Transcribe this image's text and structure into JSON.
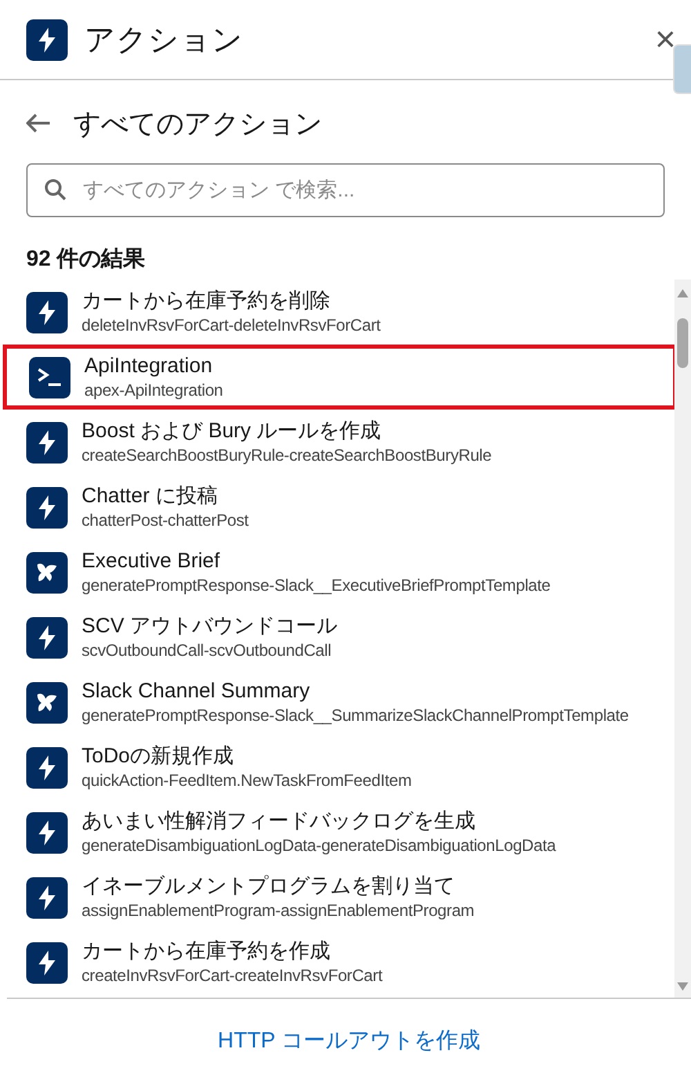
{
  "header": {
    "title": "アクション",
    "close": "×"
  },
  "subheader": {
    "title": "すべてのアクション"
  },
  "search": {
    "placeholder": "すべてのアクション で検索..."
  },
  "results": {
    "count": "92 件の結果"
  },
  "actions": [
    {
      "kind": "flow",
      "title": "カートから在庫予約を削除",
      "subtitle": "deleteInvRsvForCart-deleteInvRsvForCart",
      "highlighted": false
    },
    {
      "kind": "apex",
      "title": "ApiIntegration",
      "subtitle": "apex-ApiIntegration",
      "highlighted": true
    },
    {
      "kind": "flow",
      "title": "Boost および Bury ルールを作成",
      "subtitle": "createSearchBoostBuryRule-createSearchBoostBuryRule",
      "highlighted": false
    },
    {
      "kind": "flow",
      "title": "Chatter に投稿",
      "subtitle": "chatterPost-chatterPost",
      "highlighted": false
    },
    {
      "kind": "prompt",
      "title": "Executive Brief",
      "subtitle": "generatePromptResponse-Slack__ExecutiveBriefPromptTemplate",
      "highlighted": false
    },
    {
      "kind": "flow",
      "title": "SCV アウトバウンドコール",
      "subtitle": "scvOutboundCall-scvOutboundCall",
      "highlighted": false
    },
    {
      "kind": "prompt",
      "title": "Slack Channel Summary",
      "subtitle": "generatePromptResponse-Slack__SummarizeSlackChannelPromptTemplate",
      "highlighted": false
    },
    {
      "kind": "flow",
      "title": "ToDoの新規作成",
      "subtitle": "quickAction-FeedItem.NewTaskFromFeedItem",
      "highlighted": false
    },
    {
      "kind": "flow",
      "title": "あいまい性解消フィードバックログを生成",
      "subtitle": "generateDisambiguationLogData-generateDisambiguationLogData",
      "highlighted": false
    },
    {
      "kind": "flow",
      "title": "イネーブルメントプログラムを割り当て",
      "subtitle": "assignEnablementProgram-assignEnablementProgram",
      "highlighted": false
    },
    {
      "kind": "flow",
      "title": "カートから在庫予約を作成",
      "subtitle": "createInvRsvForCart-createInvRsvForCart",
      "highlighted": false
    }
  ],
  "footer": {
    "link": "HTTP コールアウトを作成"
  }
}
